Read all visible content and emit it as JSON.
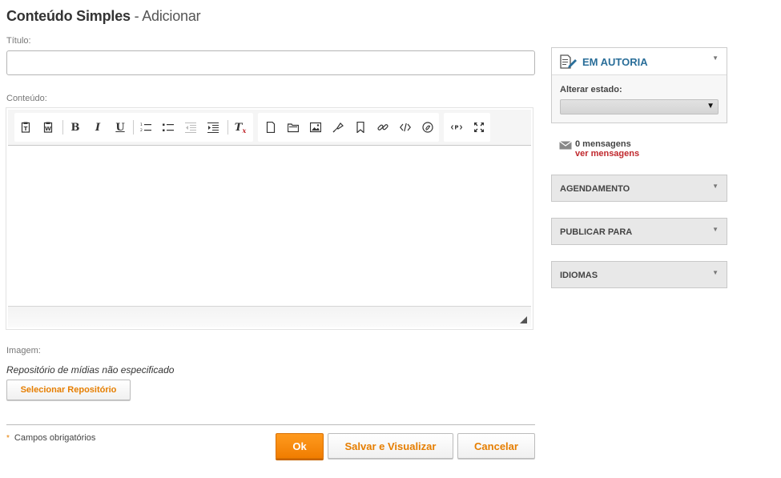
{
  "header": {
    "title_main": "Conteúdo Simples",
    "title_sub": " - Adicionar"
  },
  "form": {
    "title_label": "Título:",
    "title_value": "",
    "content_label": "Conteúdo:",
    "image_label": "Imagem:",
    "repo_text": "Repositório de mídias não especificado",
    "select_repo_label": "Selecionar Repositório",
    "required_text": "Campos obrigatórios",
    "required_marker": "*"
  },
  "actions": {
    "ok": "Ok",
    "save_view": "Salvar e Visualizar",
    "cancel": "Cancelar"
  },
  "sidebar": {
    "status_title": "EM AUTORIA",
    "alter_state_label": "Alterar estado:",
    "alter_state_value": "",
    "messages_count": "0 mensagens",
    "messages_link": "ver mensagens",
    "panels": [
      {
        "label": "AGENDAMENTO"
      },
      {
        "label": "PUBLICAR PARA"
      },
      {
        "label": "IDIOMAS"
      }
    ]
  },
  "colors": {
    "accent_orange": "#f07d00",
    "status_blue": "#2a6e99",
    "link_red": "#c0282d"
  }
}
